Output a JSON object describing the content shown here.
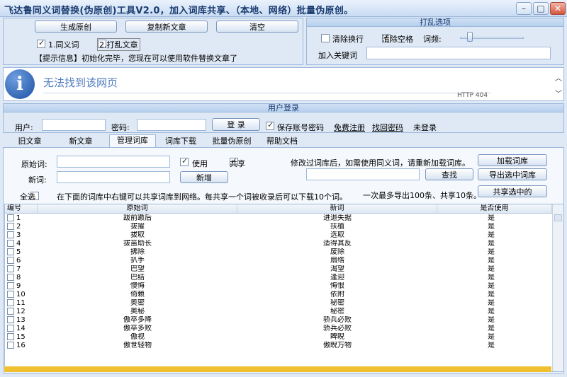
{
  "window": {
    "title": "飞达鲁同义词替换(伪原创)工具V2.0，加入词库共享、（本地、网络）批量伪原创。",
    "min": "–",
    "max": "□",
    "close": "✕"
  },
  "top": {
    "generate_label": "生成原创",
    "copy_label": "复制新文章",
    "clear_label": "清空",
    "check1_label": "1.同义词",
    "check1_checked": true,
    "check2_label": "2.打乱文章",
    "check2_checked": false,
    "info": "【提示信息】初始化完毕，您现在可以使用软件替换文章了"
  },
  "shuffle": {
    "header": "打乱选项",
    "clear_newline_label": "清除换行",
    "clear_newline_checked": false,
    "clear_space_label": "清除空格",
    "clear_space_checked": true,
    "freq_label": "词频:",
    "freq_level": 0.15,
    "keyword_label": "加入关键词",
    "keyword_value": ""
  },
  "browser": {
    "message": "无法找到该网页",
    "code": "HTTP 404",
    "icon": "info-icon"
  },
  "login": {
    "header": "用户登录",
    "user_label": "用户:",
    "user_value": "",
    "pass_label": "密码:",
    "pass_value": "",
    "login_label": "登 录",
    "save_label": "保存账号密码",
    "save_checked": true,
    "register_label": "免费注册",
    "recover_label": "找回密码",
    "status": "未登录"
  },
  "tabs": [
    "旧文章",
    "新文章",
    "管理词库",
    "词库下载",
    "批量伪原创",
    "帮助文档"
  ],
  "active_tab": 2,
  "manage": {
    "orig_label": "原始词:",
    "orig_value": "",
    "use_label": "使用",
    "use_checked": true,
    "share_label": "共享",
    "share_checked": true,
    "new_label": "新词:",
    "new_value": "",
    "add_label": "新增",
    "notice": "修改过词库后，如需使用同义词，请重新加载词库。",
    "load_label": "加载词库",
    "search_value": "",
    "find_label": "查找",
    "export_label": "导出选中词库",
    "select_all_label": "全选",
    "hint": "在下面的词库中右键可以共享词库到网络。每共享一个词被收录后可以下载10个词。",
    "limit": "一次最多导出100条、共享10条。",
    "share_sel_label": "共享选中的"
  },
  "grid": {
    "columns": [
      "编号",
      "原始词",
      "新词",
      "是否使用"
    ],
    "rows": [
      [
        "1",
        "跋前踬后",
        "进退失据",
        "是"
      ],
      [
        "2",
        "拔擢",
        "扶植",
        "是"
      ],
      [
        "3",
        "拔取",
        "选取",
        "是"
      ],
      [
        "4",
        "拔苗助长",
        "适得其反",
        "是"
      ],
      [
        "5",
        "拂除",
        "废除",
        "是"
      ],
      [
        "6",
        "扒手",
        "扇绺",
        "是"
      ],
      [
        "7",
        "巴望",
        "渴望",
        "是"
      ],
      [
        "8",
        "巴结",
        "逢迎",
        "是"
      ],
      [
        "9",
        "懊悔",
        "悔恨",
        "是"
      ],
      [
        "10",
        "倚赖",
        "依附",
        "是"
      ],
      [
        "11",
        "奥密",
        "秘密",
        "是"
      ],
      [
        "12",
        "奥秘",
        "秘密",
        "是"
      ],
      [
        "13",
        "傲卒多降",
        "骄兵必败",
        "是"
      ],
      [
        "14",
        "傲卒多败",
        "骄兵必败",
        "是"
      ],
      [
        "15",
        "傲视",
        "睥睨",
        "是"
      ],
      [
        "16",
        "傲世轻物",
        "傲睨万物",
        "是"
      ]
    ]
  }
}
